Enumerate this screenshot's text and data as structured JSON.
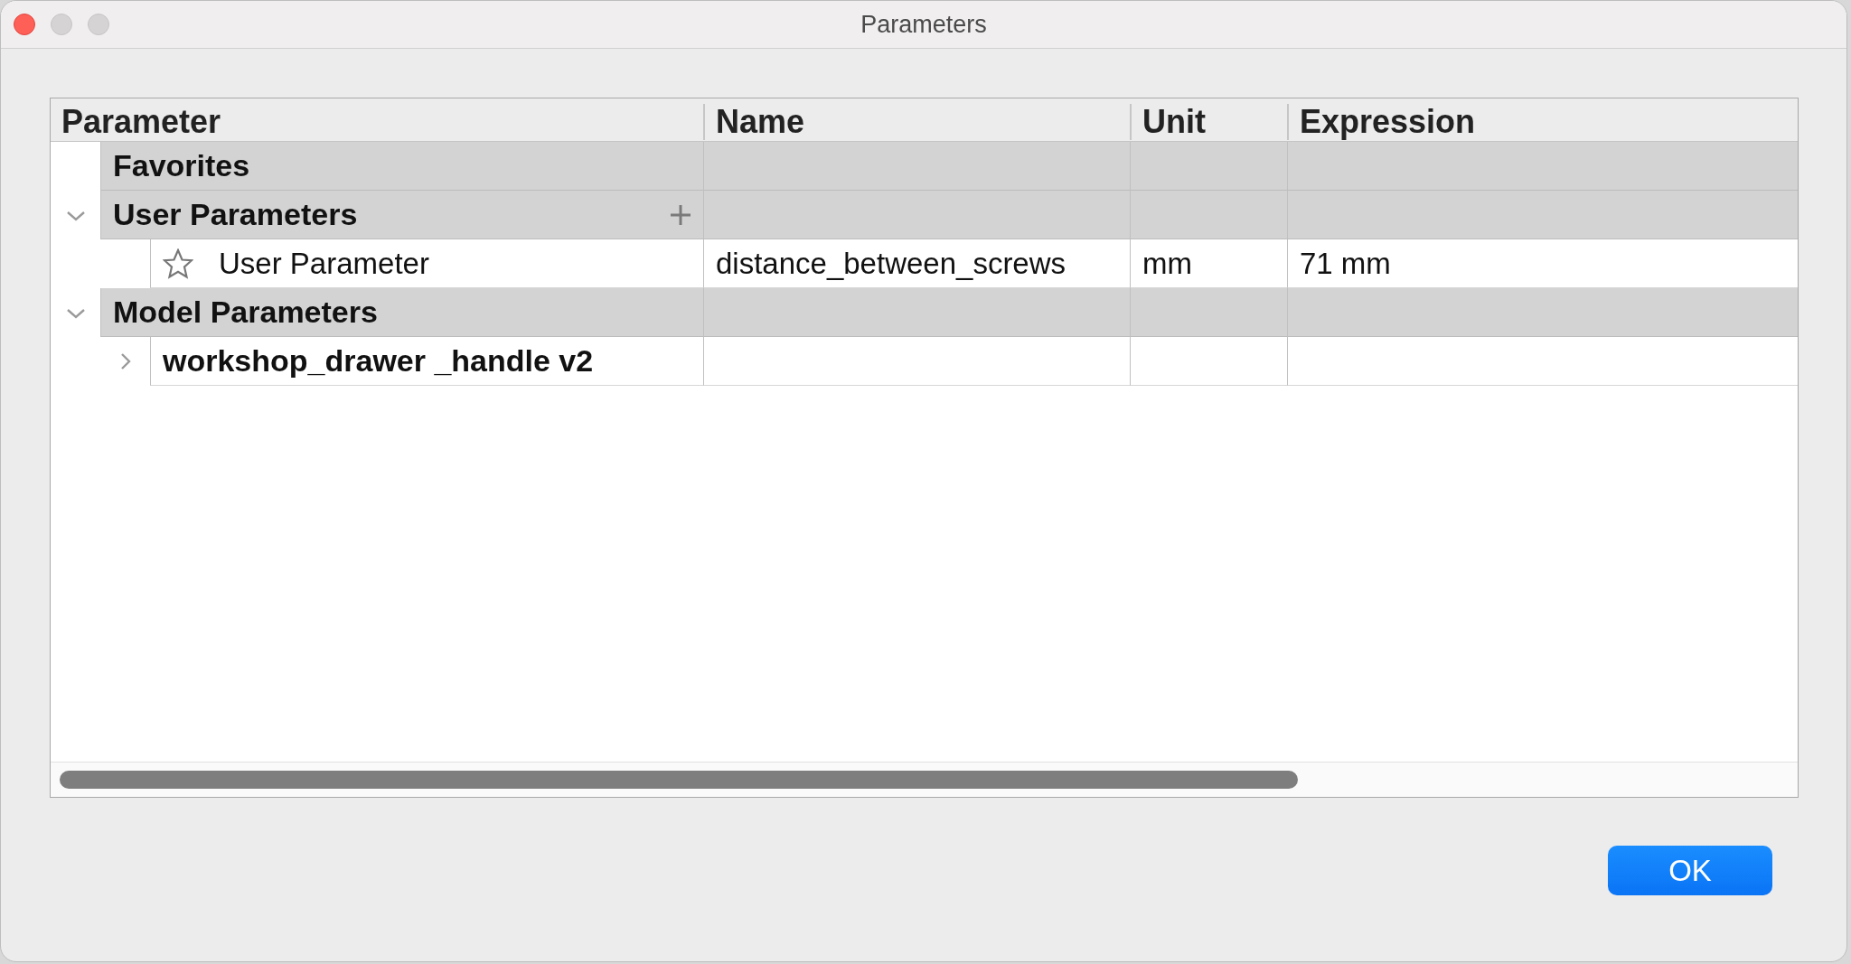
{
  "window": {
    "title": "Parameters"
  },
  "table": {
    "columns": [
      "Parameter",
      "Name",
      "Unit",
      "Expression"
    ],
    "rows": [
      {
        "kind": "section",
        "label": "Favorites",
        "addable": false
      },
      {
        "kind": "section",
        "label": "User Parameters",
        "expanded": true,
        "addable": true,
        "children": [
          {
            "kind": "parameter",
            "label": "User Parameter",
            "favorite": false,
            "name": "distance_between_screws",
            "unit": "mm",
            "expression": "71 mm"
          }
        ]
      },
      {
        "kind": "section",
        "label": "Model Parameters",
        "expanded": true,
        "addable": false,
        "children": [
          {
            "kind": "component",
            "label": "workshop_drawer _handle v2",
            "expanded": false
          }
        ]
      }
    ]
  },
  "buttons": [
    {
      "label": "OK",
      "default": true
    }
  ]
}
